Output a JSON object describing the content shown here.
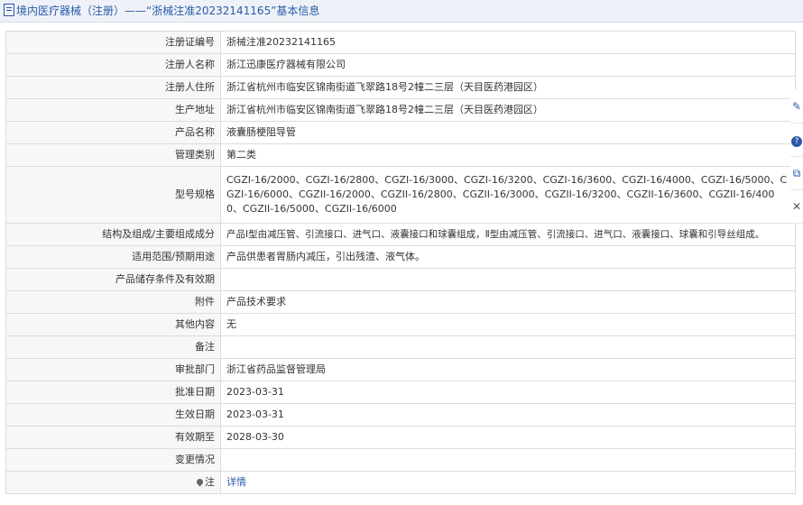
{
  "header": {
    "title": "境内医疗器械（注册）——“浙械注准20232141165”基本信息"
  },
  "rows": [
    {
      "label": "注册证编号",
      "value": "浙械注准20232141165"
    },
    {
      "label": "注册人名称",
      "value": "浙江迅康医疗器械有限公司"
    },
    {
      "label": "注册人住所",
      "value": "浙江省杭州市临安区锦南街道飞翠路18号2幢二三层（天目医药港园区）"
    },
    {
      "label": "生产地址",
      "value": "浙江省杭州市临安区锦南街道飞翠路18号2幢二三层（天目医药港园区）"
    },
    {
      "label": "产品名称",
      "value": "液囊肠梗阻导管"
    },
    {
      "label": "管理类别",
      "value": "第二类"
    },
    {
      "label": "型号规格",
      "value": "CGZI-16/2000、CGZI-16/2800、CGZI-16/3000、CGZI-16/3200、CGZI-16/3600、CGZI-16/4000、CGZI-16/5000、CGZI-16/6000、CGZII-16/2000、CGZII-16/2800、CGZII-16/3000、CGZII-16/3200、CGZII-16/3600、CGZII-16/4000、CGZII-16/5000、CGZII-16/6000"
    },
    {
      "label": "结构及组成/主要组成成分",
      "value": "产品Ⅰ型由减压管、引流接口、进气口、液囊接口和球囊组成，Ⅱ型由减压管、引流接口、进气口、液囊接口、球囊和引导丝组成。"
    },
    {
      "label": "适用范围/预期用途",
      "value": "产品供患者胃肠内减压，引出残渣、液气体。"
    },
    {
      "label": "产品储存条件及有效期",
      "value": ""
    },
    {
      "label": "附件",
      "value": "产品技术要求"
    },
    {
      "label": "其他内容",
      "value": "无"
    },
    {
      "label": "备注",
      "value": ""
    },
    {
      "label": "审批部门",
      "value": "浙江省药品监督管理局"
    },
    {
      "label": "批准日期",
      "value": "2023-03-31"
    },
    {
      "label": "生效日期",
      "value": "2023-03-31"
    },
    {
      "label": "有效期至",
      "value": "2028-03-30"
    },
    {
      "label": "变更情况",
      "value": ""
    }
  ],
  "note": {
    "label": "注",
    "link": "详情"
  },
  "side_toolbar": {
    "edit_icon": "✎",
    "help_icon": "?",
    "copy_icon": "⧉",
    "close_icon": "✕"
  }
}
